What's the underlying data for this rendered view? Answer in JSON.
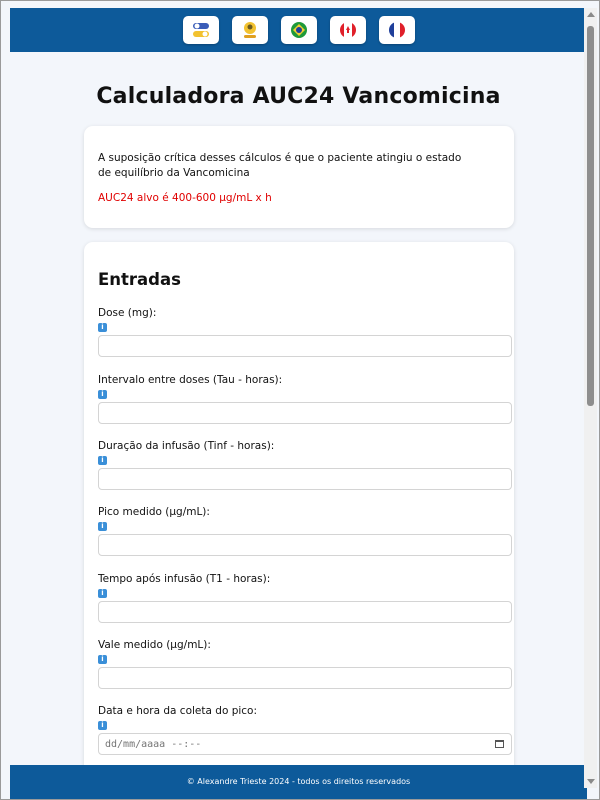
{
  "header": {
    "buttons": [
      {
        "icon": "theme-toggle-icon"
      },
      {
        "icon": "user-badge-icon"
      },
      {
        "icon": "brazil-flag-icon"
      },
      {
        "icon": "canada-flag-icon"
      },
      {
        "icon": "france-flag-icon"
      }
    ]
  },
  "page": {
    "title": "Calculadora AUC24 Vancomicina"
  },
  "info_card": {
    "note": "A suposição crítica desses cálculos é que o paciente atingiu o estado de equilíbrio da Vancomicina",
    "target": "AUC24 alvo é 400-600 µg/mL x h",
    "target_color": "#e00000"
  },
  "inputs": {
    "heading": "Entradas",
    "fields": [
      {
        "label": "Dose (mg):",
        "value": ""
      },
      {
        "label": "Intervalo entre doses (Tau - horas):",
        "value": ""
      },
      {
        "label": "Duração da infusão (Tinf - horas):",
        "value": ""
      },
      {
        "label": "Pico medido (µg/mL):",
        "value": ""
      },
      {
        "label": "Tempo após infusão (T1 - horas):",
        "value": ""
      },
      {
        "label": "Vale medido (µg/mL):",
        "value": ""
      },
      {
        "label": "Data e hora da coleta do pico:",
        "placeholder": "dd/mm/aaaa --:--"
      }
    ]
  },
  "footer": {
    "text": "© Alexandre Trieste 2024 - todos os direitos reservados"
  },
  "colors": {
    "brand": "#0d5a9a",
    "background": "#f3f6fb"
  }
}
